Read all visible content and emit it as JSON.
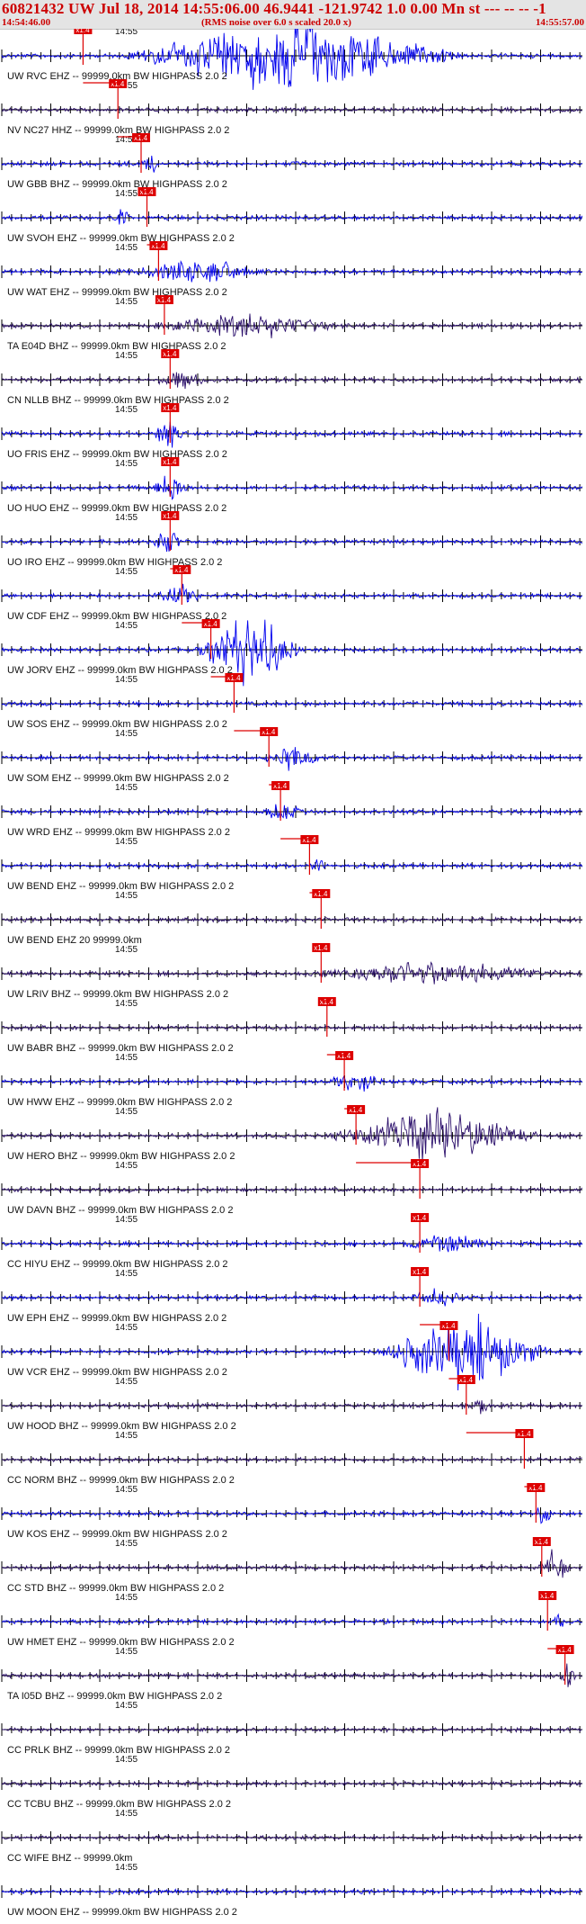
{
  "header": {
    "title": "60821432 UW Jul 18, 2014 14:55:06.00   46.9441 -121.9742  1.0 0.00 Mn st --- -- --  -1",
    "start_time": "14:54:46.00",
    "rms_note": "(RMS noise over 6.0 s scaled 20.0 x)",
    "end_time": "14:55:57.00"
  },
  "tick_label": "14:55",
  "pick_label": "x1.4",
  "colors": {
    "blue": "#0000ee",
    "navy": "#2b0f6b",
    "pick": "#dd0000",
    "axis": "#000000",
    "title": "#cc0000"
  },
  "traces": [
    {
      "label": "UW RVC EHZ -- 99999.0km BW  HIGHPASS  2.0  2",
      "color": "blue",
      "pick": 0.14,
      "burst": [
        0.2,
        0.8,
        6.0
      ]
    },
    {
      "label": "NV NC27 HHZ -- 99999.0km BW  HIGHPASS  2.0  2",
      "color": "navy",
      "pick": 0.2,
      "burst": null
    },
    {
      "label": "UW GBB BHZ -- 99999.0km BW  HIGHPASS  2.0  2",
      "color": "blue",
      "pick": 0.24,
      "burst": [
        0.24,
        0.27,
        2.0
      ]
    },
    {
      "label": "UW SVOH EHZ -- 99999.0km BW  HIGHPASS  2.0  2",
      "color": "blue",
      "pick": 0.25,
      "burst": [
        0.19,
        0.22,
        3.0
      ]
    },
    {
      "label": "UW WAT EHZ -- 99999.0km BW  HIGHPASS  2.0  2",
      "color": "blue",
      "pick": 0.27,
      "burst": [
        0.22,
        0.45,
        2.2
      ]
    },
    {
      "label": "TA E04D BHZ -- 99999.0km BW  HIGHPASS  2.0  2",
      "color": "navy",
      "pick": 0.28,
      "burst": [
        0.25,
        0.6,
        2.0
      ]
    },
    {
      "label": "CN NLLB BHZ -- 99999.0km BW  HIGHPASS  2.0  2",
      "color": "navy",
      "pick": 0.29,
      "burst": [
        0.26,
        0.36,
        1.4
      ]
    },
    {
      "label": "UO FRIS EHZ -- 99999.0km BW  HIGHPASS  2.0  2",
      "color": "blue",
      "pick": 0.29,
      "burst": [
        0.26,
        0.32,
        2.6
      ]
    },
    {
      "label": "UO HUO EHZ -- 99999.0km BW  HIGHPASS  2.0  2",
      "color": "blue",
      "pick": 0.29,
      "burst": [
        0.26,
        0.32,
        2.8
      ]
    },
    {
      "label": "UO IRO EHZ -- 99999.0km BW  HIGHPASS  2.0  2",
      "color": "blue",
      "pick": 0.29,
      "burst": [
        0.26,
        0.31,
        3.0
      ]
    },
    {
      "label": "UW CDF EHZ -- 99999.0km BW  HIGHPASS  2.0  2",
      "color": "blue",
      "pick": 0.31,
      "burst": [
        0.26,
        0.35,
        1.8
      ]
    },
    {
      "label": "UW JORV EHZ -- 99999.0km BW  HIGHPASS  2.0  2",
      "color": "blue",
      "pick": 0.36,
      "burst": [
        0.33,
        0.52,
        6.0
      ]
    },
    {
      "label": "UW SOS EHZ -- 99999.0km BW  HIGHPASS  2.0  2",
      "color": "blue",
      "pick": 0.4,
      "burst": null
    },
    {
      "label": "UW SOM EHZ -- 99999.0km BW  HIGHPASS  2.0  2",
      "color": "blue",
      "pick": 0.46,
      "burst": [
        0.45,
        0.55,
        2.2
      ]
    },
    {
      "label": "UW WRD EHZ -- 99999.0km BW  HIGHPASS  2.0  2",
      "color": "blue",
      "pick": 0.48,
      "burst": [
        0.45,
        0.52,
        1.6
      ]
    },
    {
      "label": "UW BEND EHZ -- 99999.0km BW  HIGHPASS  2.0  2",
      "color": "blue",
      "pick": 0.53,
      "burst": [
        0.53,
        0.56,
        1.6
      ]
    },
    {
      "label": "UW BEND EHZ 20 99999.0km",
      "color": "navy",
      "pick": 0.55,
      "burst": null
    },
    {
      "label": "UW LRIV BHZ -- 99999.0km BW  HIGHPASS  2.0  2",
      "color": "navy",
      "pick": 0.55,
      "burst": [
        0.52,
        0.98,
        2.0
      ]
    },
    {
      "label": "UW BABR BHZ -- 99999.0km BW  HIGHPASS  2.0  2",
      "color": "navy",
      "pick": 0.56,
      "burst": null
    },
    {
      "label": "UW HWW EHZ -- 99999.0km BW  HIGHPASS  2.0  2",
      "color": "blue",
      "pick": 0.59,
      "burst": [
        0.56,
        0.66,
        1.8
      ]
    },
    {
      "label": "UW HERO BHZ -- 99999.0km BW  HIGHPASS  2.0  2",
      "color": "navy",
      "pick": 0.61,
      "burst": [
        0.56,
        0.93,
        4.5
      ]
    },
    {
      "label": "UW DAVN BHZ -- 99999.0km BW  HIGHPASS  2.0  2",
      "color": "navy",
      "pick": 0.72,
      "burst": null
    },
    {
      "label": "CC HIYU EHZ -- 99999.0km BW  HIGHPASS  2.0  2",
      "color": "blue",
      "pick": 0.72,
      "burst": [
        0.68,
        0.85,
        1.6
      ]
    },
    {
      "label": "UW EPH EHZ -- 99999.0km BW  HIGHPASS  2.0  2",
      "color": "blue",
      "pick": 0.72,
      "burst": [
        0.7,
        0.8,
        1.4
      ]
    },
    {
      "label": "UW VCR EHZ -- 99999.0km BW  HIGHPASS  2.0  2",
      "color": "blue",
      "pick": 0.77,
      "burst": [
        0.64,
        0.95,
        6.0
      ]
    },
    {
      "label": "UW HOOD BHZ -- 99999.0km BW  HIGHPASS  2.0  2",
      "color": "navy",
      "pick": 0.8,
      "burst": [
        0.81,
        0.84,
        2.0
      ]
    },
    {
      "label": "CC NORM BHZ -- 99999.0km BW  HIGHPASS  2.0  2",
      "color": "navy",
      "pick": 0.9,
      "burst": null
    },
    {
      "label": "UW KOS EHZ -- 99999.0km BW  HIGHPASS  2.0  2",
      "color": "blue",
      "pick": 0.92,
      "burst": [
        0.92,
        0.95,
        4.5
      ]
    },
    {
      "label": "CC STD BHZ -- 99999.0km BW  HIGHPASS  2.0  2",
      "color": "navy",
      "pick": 0.93,
      "burst": [
        0.92,
        0.98,
        2.6
      ]
    },
    {
      "label": "UW HMET EHZ -- 99999.0km BW  HIGHPASS  2.0  2",
      "color": "blue",
      "pick": 0.94,
      "burst": [
        0.95,
        0.97,
        1.6
      ]
    },
    {
      "label": "TA I05D BHZ -- 99999.0km BW  HIGHPASS  2.0  2",
      "color": "navy",
      "pick": 0.97,
      "burst": [
        0.96,
        0.99,
        2.4
      ]
    },
    {
      "label": "CC PRLK BHZ -- 99999.0km BW  HIGHPASS  2.0  2",
      "color": "navy",
      "pick": null,
      "burst": null
    },
    {
      "label": "CC TCBU BHZ -- 99999.0km BW  HIGHPASS  2.0  2",
      "color": "navy",
      "pick": null,
      "burst": null
    },
    {
      "label": "CC WIFE BHZ -- 99999.0km",
      "color": "navy",
      "pick": null,
      "burst": null
    },
    {
      "label": "UW MOON EHZ -- 99999.0km BW  HIGHPASS  2.0  2",
      "color": "blue",
      "pick": null,
      "burst": null
    }
  ]
}
